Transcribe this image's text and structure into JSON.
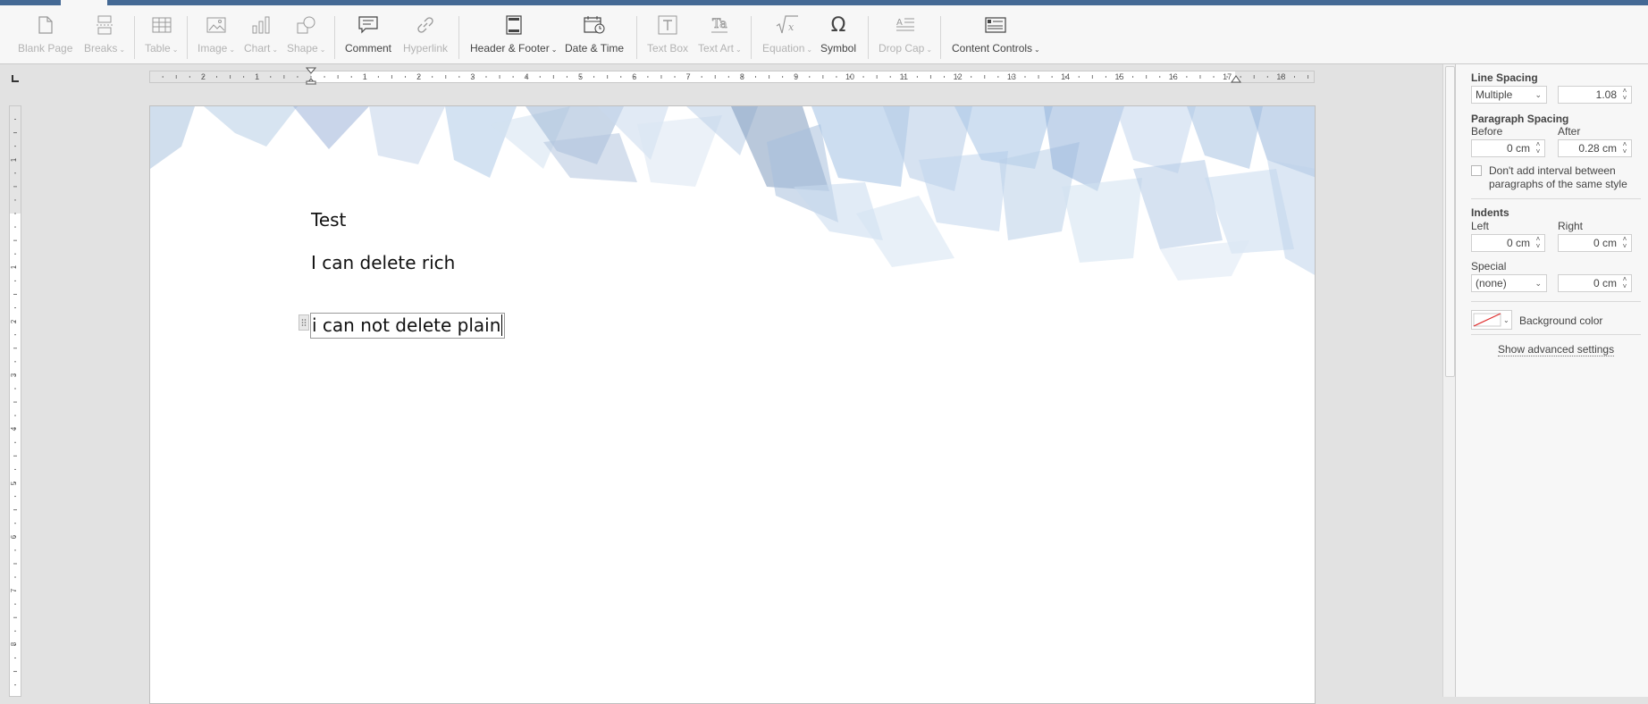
{
  "toolbar": {
    "buttons": [
      {
        "key": "blank",
        "label": "Blank Page",
        "arrow": ""
      },
      {
        "key": "breaks",
        "label": "Breaks",
        "arrow": "⌄"
      },
      {
        "key": "table",
        "label": "Table",
        "arrow": "⌄"
      },
      {
        "key": "image",
        "label": "Image",
        "arrow": "⌄"
      },
      {
        "key": "chart",
        "label": "Chart",
        "arrow": "⌄"
      },
      {
        "key": "shape",
        "label": "Shape",
        "arrow": "⌄"
      },
      {
        "key": "comment",
        "label": "Comment",
        "arrow": ""
      },
      {
        "key": "hyperlink",
        "label": "Hyperlink",
        "arrow": ""
      },
      {
        "key": "header",
        "label": "Header & Footer",
        "arrow": "⌄"
      },
      {
        "key": "datetime",
        "label": "Date & Time",
        "arrow": ""
      },
      {
        "key": "textbox",
        "label": "Text Box",
        "arrow": ""
      },
      {
        "key": "textart",
        "label": "Text Art",
        "arrow": "⌄"
      },
      {
        "key": "equation",
        "label": "Equation",
        "arrow": "⌄"
      },
      {
        "key": "symbol",
        "label": "Symbol",
        "arrow": ""
      },
      {
        "key": "dropcap",
        "label": "Drop Cap",
        "arrow": "⌄"
      },
      {
        "key": "controls",
        "label": "Content Controls",
        "arrow": "⌄"
      }
    ]
  },
  "ruler": {
    "labels": [
      "2",
      "1",
      "1",
      "2",
      "3",
      "4",
      "5",
      "6",
      "7",
      "8",
      "9",
      "10",
      "11",
      "12",
      "13",
      "14",
      "15",
      "16",
      "17",
      "18"
    ],
    "vlabels": [
      "1",
      "1",
      "2",
      "3",
      "4",
      "5",
      "6",
      "7",
      "8"
    ]
  },
  "document": {
    "paragraphs": [
      "Test",
      "I can delete rich",
      "i can not delete plain"
    ]
  },
  "panel": {
    "line_spacing_title": "Line Spacing",
    "line_spacing_type": "Multiple",
    "line_spacing_value": "1.08",
    "paragraph_spacing_title": "Paragraph Spacing",
    "before_label": "Before",
    "after_label": "After",
    "before_value": "0 cm",
    "after_value": "0.28 cm",
    "dont_add_interval": "Don't add interval between paragraphs of the same style",
    "indents_title": "Indents",
    "left_label": "Left",
    "right_label": "Right",
    "left_value": "0 cm",
    "right_value": "0 cm",
    "special_label": "Special",
    "special_type": "(none)",
    "special_value": "0 cm",
    "background_color": "Background color",
    "advanced": "Show advanced settings"
  },
  "colors": {
    "accent": "#446995",
    "toolbar_bg": "#f7f7f7",
    "workspace_bg": "#e2e2e2"
  }
}
